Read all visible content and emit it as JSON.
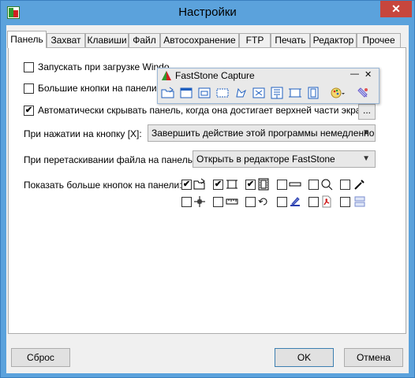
{
  "window": {
    "title": "Настройки",
    "close_glyph": "✕"
  },
  "tabs": [
    "Панель",
    "Захват",
    "Клавиши",
    "Файл",
    "Автосохранение",
    "FTP",
    "Печать",
    "Редактор",
    "Прочее"
  ],
  "panel": {
    "startup_label": "Запускать при загрузке Windo",
    "big_buttons_label": "Большие кнопки на панели",
    "autohide_label": "Автоматически скрывать панель, когда она достигает верхней части экрана",
    "dots_label": "...",
    "on_click_label": "При нажатии на кнопку [X]:",
    "on_click_value": "Завершить действие этой программы немедленно",
    "on_drag_label": "При перетаскивании файла на панель:",
    "on_drag_value": "Открыть в редакторе FastStone",
    "more_buttons_label": "Показать больше кнопок на панели:",
    "startup_checked": false,
    "big_buttons_checked": false,
    "autohide_checked": true,
    "extra_buttons": [
      {
        "name": "open-icon",
        "checked": true
      },
      {
        "name": "crop-icon",
        "checked": true
      },
      {
        "name": "film-icon",
        "checked": true
      },
      {
        "name": "line-icon",
        "checked": false
      },
      {
        "name": "magnifier-icon",
        "checked": false
      },
      {
        "name": "color-picker-icon",
        "checked": false
      },
      {
        "name": "crosshair-icon",
        "checked": false
      },
      {
        "name": "ruler-icon",
        "checked": false
      },
      {
        "name": "undo-icon",
        "checked": false
      },
      {
        "name": "draw-icon",
        "checked": false
      },
      {
        "name": "pdf-icon",
        "checked": false
      },
      {
        "name": "compare-icon",
        "checked": false
      }
    ]
  },
  "floating_toolbar": {
    "title": "FastStone Capture",
    "minimize_glyph": "—",
    "close_glyph": "✕",
    "icons": [
      "open-folder-icon",
      "capture-window-icon",
      "capture-object-icon",
      "capture-rect-icon",
      "capture-freehand-icon",
      "capture-fullscreen-icon",
      "capture-scroll-icon",
      "capture-fixed-icon",
      "video-record-icon",
      "output-settings-icon",
      "settings-icon"
    ]
  },
  "buttons": {
    "reset": "Сброс",
    "ok": "OK",
    "cancel": "Отмена"
  },
  "colors": {
    "titlebar": "#5ba2dc",
    "close": "#c7463d",
    "accent_blue": "#1f5fbf"
  }
}
